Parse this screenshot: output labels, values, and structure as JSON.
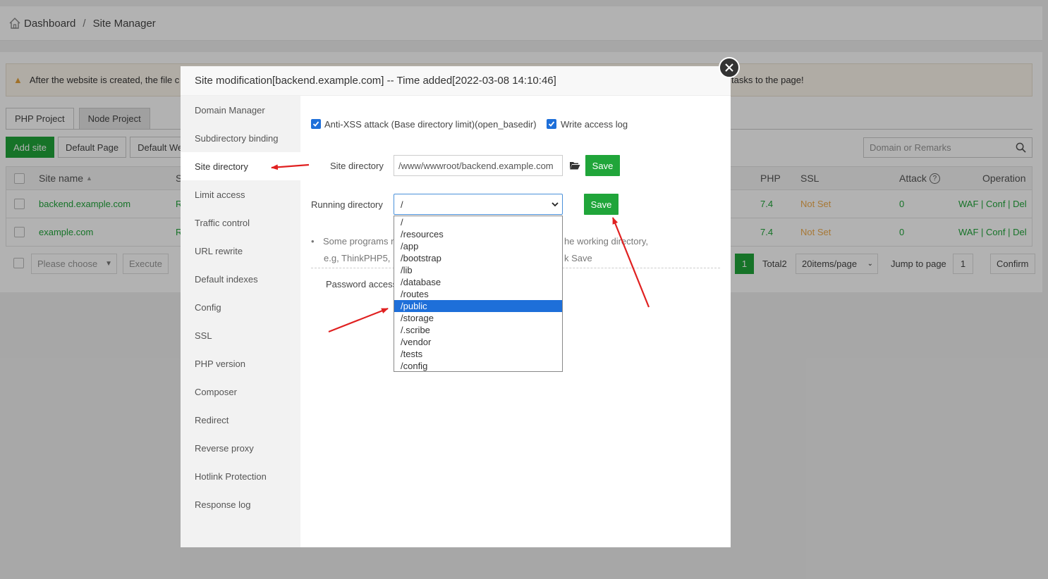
{
  "breadcrumb": {
    "home": "Dashboard",
    "separator": "/",
    "current": "Site Manager"
  },
  "notice": {
    "text_start": "After the website is created, the file c",
    "text_end": "tasks to the page!"
  },
  "project_tabs": [
    "PHP Project",
    "Node Project"
  ],
  "toolbar": {
    "add_site": "Add site",
    "default_page": "Default Page",
    "default_web": "Default We"
  },
  "search": {
    "placeholder": "Domain or Remarks"
  },
  "table": {
    "headers": {
      "site_name": "Site name",
      "status_partial": "S",
      "php": "PHP",
      "ssl": "SSL",
      "attack": "Attack",
      "operation": "Operation"
    },
    "rows": [
      {
        "site": "backend.example.com",
        "status_partial": "R",
        "php": "7.4",
        "ssl": "Not Set",
        "attack": "0",
        "ops": [
          "WAF",
          "Conf",
          "Del"
        ]
      },
      {
        "site": "example.com",
        "status_partial": "R",
        "php": "7.4",
        "ssl": "Not Set",
        "attack": "0",
        "ops": [
          "WAF",
          "Conf",
          "Del"
        ]
      }
    ],
    "op_separator": "|"
  },
  "footer": {
    "batch_placeholder": "Please choose",
    "execute": "Execute",
    "current_page": "1",
    "total": "Total2",
    "per_page": "20items/page",
    "jump_label": "Jump to page",
    "jump_value": "1",
    "confirm": "Confirm"
  },
  "modal": {
    "title": "Site modification[backend.example.com] -- Time added[2022-03-08 14:10:46]",
    "menu": [
      "Domain Manager",
      "Subdirectory binding",
      "Site directory",
      "Limit access",
      "Traffic control",
      "URL rewrite",
      "Default indexes",
      "Config",
      "SSL",
      "PHP version",
      "Composer",
      "Redirect",
      "Reverse proxy",
      "Hotlink Protection",
      "Response log"
    ],
    "active_menu": "Site directory",
    "anti_xss_label": "Anti-XSS attack (Base directory limit)(open_basedir)",
    "write_log_label": "Write access log",
    "site_dir_label": "Site directory",
    "site_dir_value": "/www/wwwroot/backend.example.com",
    "save_label": "Save",
    "running_dir_label": "Running directory",
    "running_dir_value": "/",
    "tip_line1_start": "Some programs n",
    "tip_line1_end": "he working directory,",
    "tip_line2_start": "e.g, ThinkPHP5, L",
    "tip_line2_end": "k Save",
    "password_access_label": "Password access",
    "dropdown_options": [
      "/",
      "/resources",
      "/app",
      "/bootstrap",
      "/lib",
      "/database",
      "/routes",
      "/public",
      "/storage",
      "/.scribe",
      "/vendor",
      "/tests",
      "/config"
    ],
    "highlighted_option": "/public"
  },
  "colors": {
    "accent_green": "#20a53a",
    "highlight_blue": "#1e6fd9",
    "ssl_orange": "#f0ad4e",
    "arrow_red": "#e02020"
  }
}
